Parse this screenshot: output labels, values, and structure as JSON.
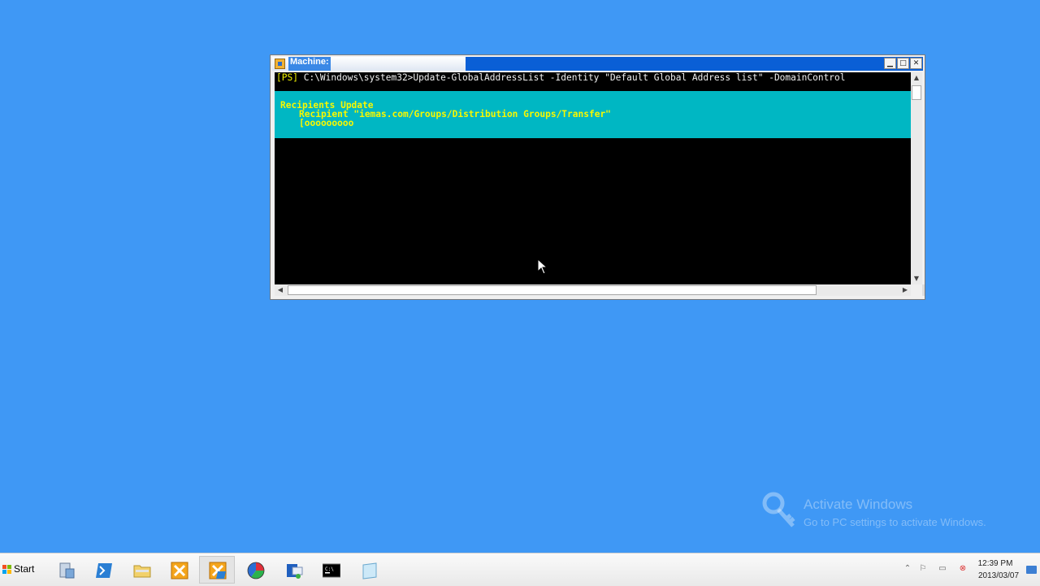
{
  "window": {
    "title": "Machine:",
    "buttons": {
      "minimize": "▁",
      "maximize": "□",
      "close": "✕"
    }
  },
  "console": {
    "prompt": "[PS]",
    "command": "C:\\Windows\\system32>Update-GlobalAddressList -Identity \"Default Global Address list\" -DomainControl",
    "progress": {
      "activity": "Recipients Update",
      "status": "Recipient \"iemas.com/Groups/Distribution Groups/Transfer\"",
      "bar": "[ooooooooo"
    }
  },
  "watermark": {
    "title": "Activate Windows",
    "subtitle": "Go to PC settings to activate Windows."
  },
  "taskbar": {
    "start_label": "Start",
    "items": [
      {
        "icon": "server-manager-icon"
      },
      {
        "icon": "powershell-icon"
      },
      {
        "icon": "folder-icon"
      },
      {
        "icon": "exchange-console-icon"
      },
      {
        "icon": "exchange-shell-icon",
        "active": true
      },
      {
        "icon": "pie-chart-icon"
      },
      {
        "icon": "outlook-icon"
      },
      {
        "icon": "command-prompt-icon"
      },
      {
        "icon": "blank-document-icon"
      }
    ],
    "clock_time": "12:39 PM",
    "clock_date": "2013/03/07"
  }
}
